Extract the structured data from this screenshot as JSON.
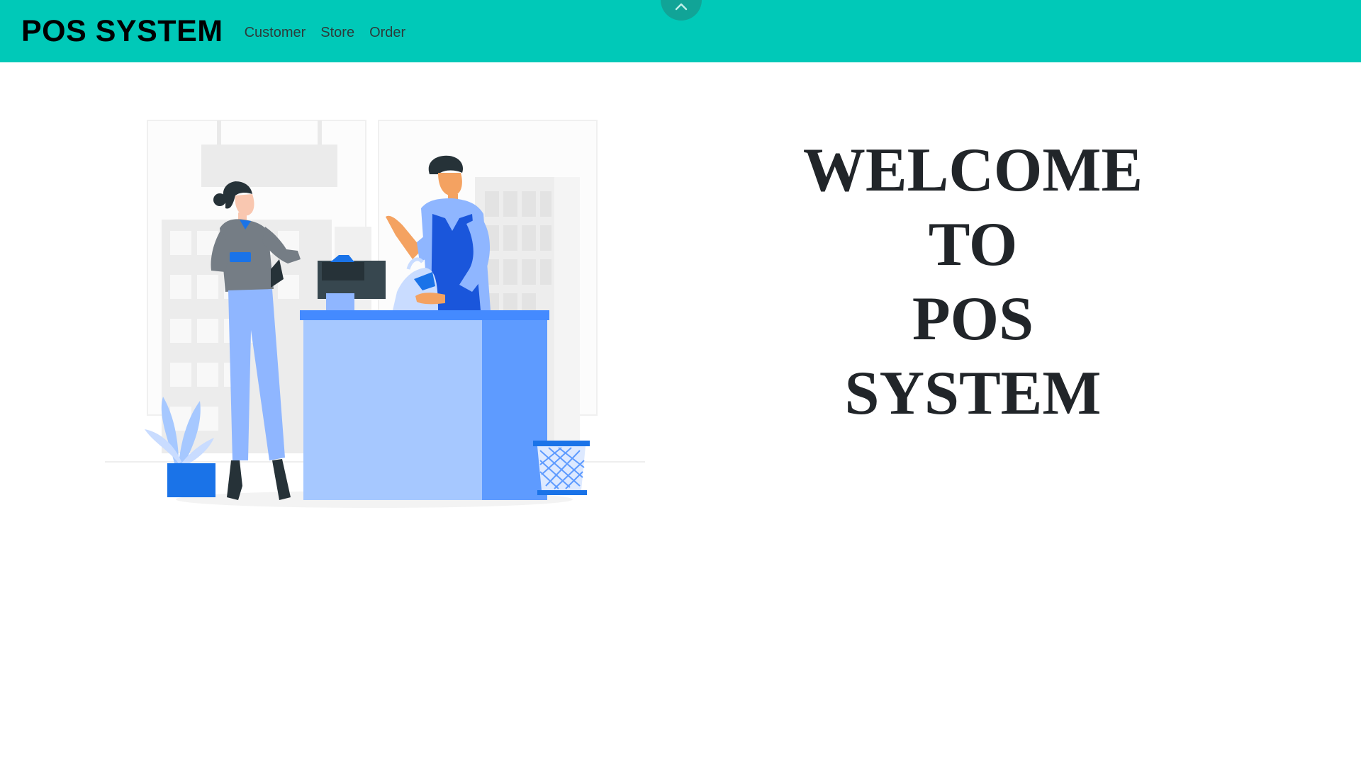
{
  "navbar": {
    "brand": "POS SYSTEM",
    "links": [
      {
        "label": "Customer"
      },
      {
        "label": "Store"
      },
      {
        "label": "Order"
      }
    ],
    "background_color": "#00c9b8",
    "toggle_icon": "chevron-up-icon"
  },
  "hero": {
    "illustration": "cashier-checkout-illustration",
    "welcome_lines": [
      "WELCOME",
      "TO",
      "POS",
      "SYSTEM"
    ],
    "accent_color": "#1a73e8"
  }
}
